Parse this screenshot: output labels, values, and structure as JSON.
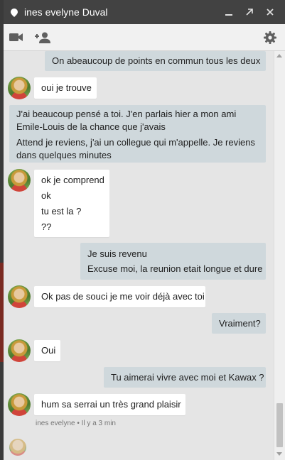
{
  "window": {
    "title": "ines evelyne Duval",
    "minimize_icon": "minimize-icon",
    "popout_icon": "popout-icon",
    "close_icon": "close-icon"
  },
  "toolbar": {
    "video_icon": "video-call-icon",
    "add_person_icon": "add-person-icon",
    "settings_icon": "gear-icon"
  },
  "messages": [
    {
      "dir": "out",
      "lines": [
        "On abeaucoup de points en commun tous les deux"
      ]
    },
    {
      "dir": "in",
      "lines": [
        "oui je trouve"
      ]
    },
    {
      "dir": "out",
      "lines": [
        "J'ai beaucoup pensé a toi. J'en parlais hier a mon ami",
        "Emile-Louis de la chance que j'avais"
      ]
    },
    {
      "dir": "out",
      "lines": [
        "Attend je reviens, j'ai un collegue qui m'appelle. Je reviens",
        "dans quelques minutes"
      ]
    },
    {
      "dir": "in",
      "lines": [
        "ok je comprend",
        "ok",
        "tu est la ?",
        "??"
      ]
    },
    {
      "dir": "out",
      "lines": [
        "Je suis revenu",
        "Excuse moi, la reunion etait longue et dure"
      ]
    },
    {
      "dir": "in",
      "lines": [
        "Ok pas de souci je me voir déjà avec toi"
      ]
    },
    {
      "dir": "out",
      "lines": [
        "Vraiment?"
      ]
    },
    {
      "dir": "in",
      "lines": [
        "Oui"
      ]
    },
    {
      "dir": "out",
      "lines": [
        "Tu aimerai vivre avec moi et Kawax ?"
      ]
    },
    {
      "dir": "in",
      "lines": [
        "hum sa serrai un très grand plaisir"
      ]
    }
  ],
  "last_seen": "ines evelyne • Il y a 3 min"
}
